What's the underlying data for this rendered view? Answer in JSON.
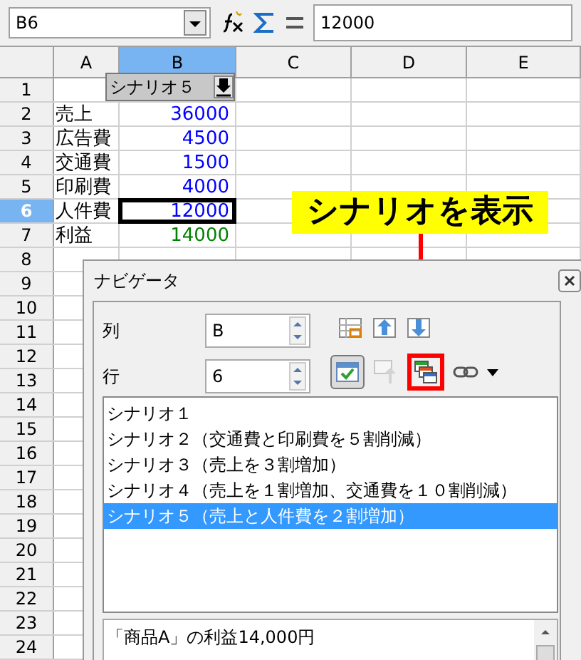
{
  "formula_bar": {
    "cell_ref": "B6",
    "formula": "12000"
  },
  "columns": [
    {
      "label": "A",
      "selected": false
    },
    {
      "label": "B",
      "selected": true
    },
    {
      "label": "C",
      "selected": false
    },
    {
      "label": "D",
      "selected": false
    },
    {
      "label": "E",
      "selected": false
    }
  ],
  "scenario_dropdown": {
    "label": "シナリオ５"
  },
  "rows": [
    {
      "number": "1",
      "selected": false
    },
    {
      "number": "2",
      "selected": false,
      "label": "売上",
      "value": "36000",
      "color": "#0000ff"
    },
    {
      "number": "3",
      "selected": false,
      "label": "広告費",
      "value": "4500",
      "color": "#0000ff"
    },
    {
      "number": "4",
      "selected": false,
      "label": "交通費",
      "value": "1500",
      "color": "#0000ff"
    },
    {
      "number": "5",
      "selected": false,
      "label": "印刷費",
      "value": "4000",
      "color": "#0000ff"
    },
    {
      "number": "6",
      "selected": true,
      "label": "人件費",
      "value": "12000",
      "color": "#0000ff"
    },
    {
      "number": "7",
      "selected": false,
      "label": "利益",
      "value": "14000",
      "color": "#008000"
    },
    {
      "number": "8",
      "selected": false
    },
    {
      "number": "9",
      "selected": false
    },
    {
      "number": "10",
      "selected": false
    },
    {
      "number": "11",
      "selected": false
    },
    {
      "number": "12",
      "selected": false
    },
    {
      "number": "13",
      "selected": false
    },
    {
      "number": "14",
      "selected": false
    },
    {
      "number": "15",
      "selected": false
    },
    {
      "number": "16",
      "selected": false
    },
    {
      "number": "17",
      "selected": false
    },
    {
      "number": "18",
      "selected": false
    },
    {
      "number": "19",
      "selected": false
    },
    {
      "number": "20",
      "selected": false
    },
    {
      "number": "21",
      "selected": false
    },
    {
      "number": "22",
      "selected": false
    },
    {
      "number": "23",
      "selected": false
    },
    {
      "number": "24",
      "selected": false
    }
  ],
  "callout": "シナリオを表示",
  "navigator": {
    "title": "ナビゲータ",
    "column_label": "列",
    "column_value": "B",
    "row_label": "行",
    "row_value": "6",
    "scenarios": [
      {
        "label": "シナリオ１",
        "selected": false
      },
      {
        "label": "シナリオ２（交通費と印刷費を５割削減）",
        "selected": false
      },
      {
        "label": "シナリオ３（売上を３割増加）",
        "selected": false
      },
      {
        "label": "シナリオ４（売上を１割増加、交通費を１０割削減）",
        "selected": false
      },
      {
        "label": "シナリオ５（売上と人件費を２割増加）",
        "selected": true
      }
    ],
    "comment": "「商品A」の利益14,000円"
  }
}
